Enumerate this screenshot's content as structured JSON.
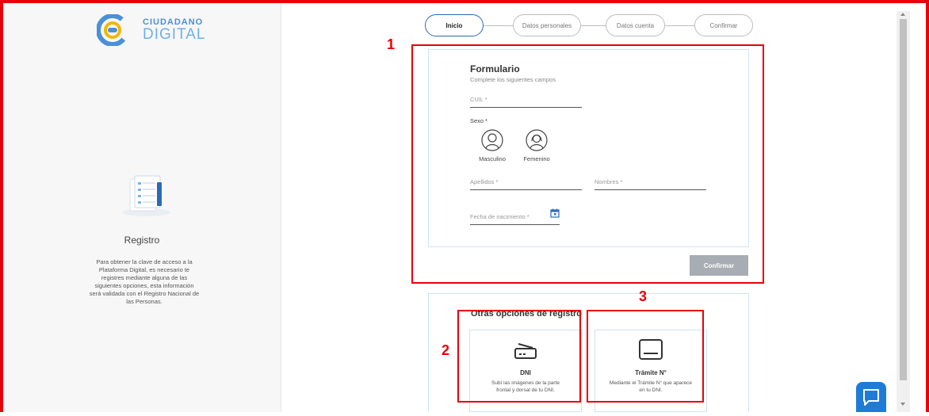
{
  "brand": {
    "line1": "CIUDADANO",
    "line2": "DIGITAL"
  },
  "sidebar": {
    "title": "Registro",
    "description": "Para obtener la clave de acceso a la Plataforma Digital, es necesario te registres mediante alguna de las siguientes opciones, esta información será validada con el Registro Nacional de las Personas."
  },
  "stepper": {
    "steps": [
      "Inicio",
      "Datos personales",
      "Datos cuenta",
      "Confirmar"
    ],
    "active": 0
  },
  "form": {
    "title": "Formulario",
    "subtitle": "Complete los siguientes campos",
    "cuil_placeholder": "CUIL *",
    "sexo_label": "Sexo *",
    "sexo_options": [
      "Masculino",
      "Femenino"
    ],
    "apellidos_placeholder": "Apellidos *",
    "nombres_placeholder": "Nombres *",
    "fecha_placeholder": "Fecha de nacimiento *",
    "confirm_label": "Confirmar"
  },
  "other_options": {
    "title": "Otras opciones de registro",
    "items": [
      {
        "title": "DNI",
        "desc": "Subí las imágenes de la parte frontal y dorsal de tu DNI.",
        "icon": "scanner-icon"
      },
      {
        "title": "Trámite N°",
        "desc": "Mediante el Trámite N° que aparece en tu DNI.",
        "icon": "id-card-icon"
      }
    ]
  },
  "annotations": [
    "1",
    "2",
    "3"
  ],
  "colors": {
    "accent": "#2d6ab3",
    "annotation": "#e8000b",
    "chat": "#1f7bd8"
  }
}
